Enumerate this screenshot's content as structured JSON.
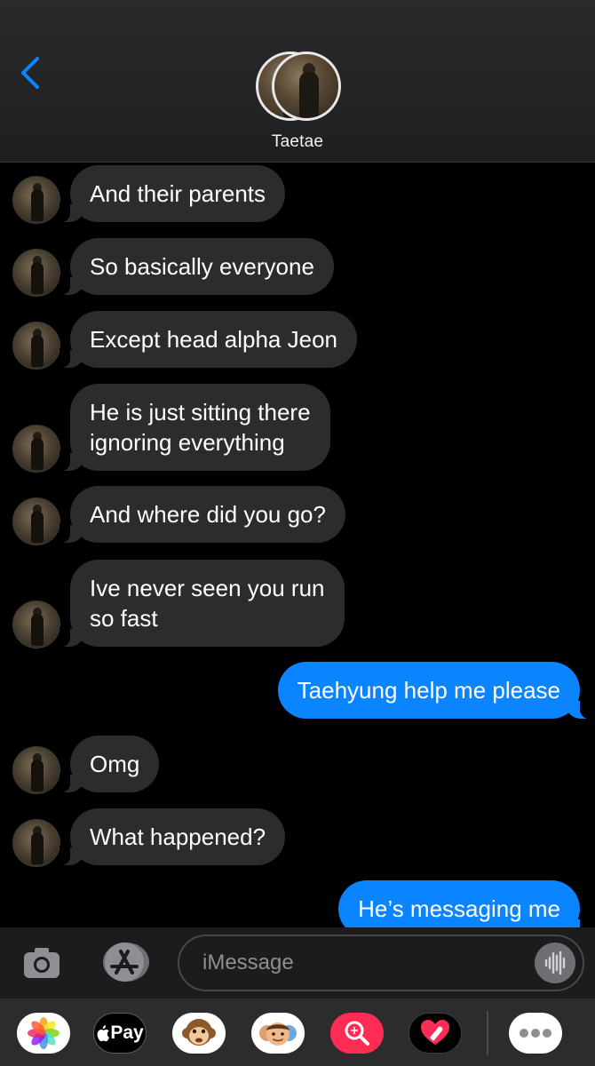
{
  "header": {
    "contact_name": "Taetae"
  },
  "messages": [
    {
      "dir": "in",
      "text": "And their parents"
    },
    {
      "dir": "in",
      "text": "So basically everyone"
    },
    {
      "dir": "in",
      "text": "Except head alpha Jeon"
    },
    {
      "dir": "in",
      "text": "He is just sitting there\nignoring everything"
    },
    {
      "dir": "in",
      "text": "And where did you go?"
    },
    {
      "dir": "in",
      "text": "Ive never seen you run\nso fast"
    },
    {
      "dir": "out",
      "text": "Taehyung help me please"
    },
    {
      "dir": "in",
      "text": "Omg"
    },
    {
      "dir": "in",
      "text": "What happened?"
    },
    {
      "dir": "out",
      "text": "He’s messaging me"
    }
  ],
  "input": {
    "placeholder": "iMessage"
  },
  "app_drawer": {
    "apps": [
      {
        "icon": "photos-icon"
      },
      {
        "icon": "apple-pay-icon",
        "label": "Pay"
      },
      {
        "icon": "animoji-monkey-icon"
      },
      {
        "icon": "memoji-icon"
      },
      {
        "icon": "images-search-icon"
      },
      {
        "icon": "digital-touch-icon"
      },
      {
        "icon": "more-apps-icon"
      }
    ]
  },
  "colors": {
    "incoming_bubble": "#2c2c2e",
    "outgoing_bubble": "#0b84ff",
    "accent": "#0b84ff",
    "background": "#000000"
  }
}
